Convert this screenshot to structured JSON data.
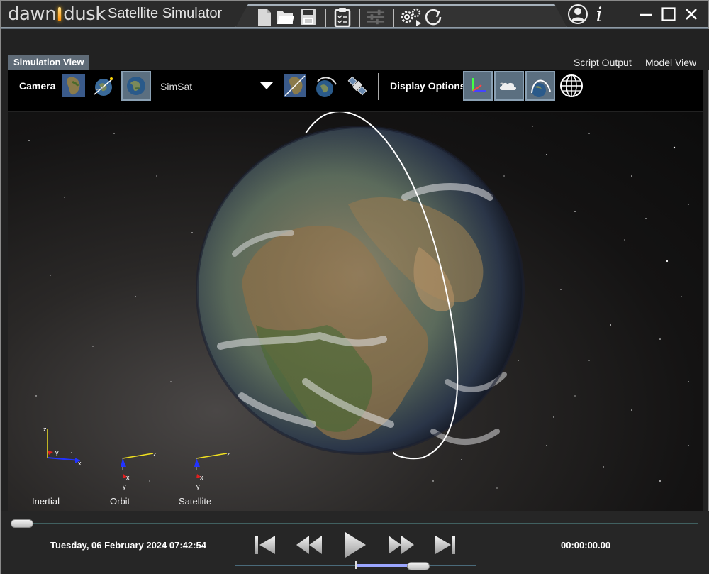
{
  "app": {
    "brand_left": "dawn",
    "brand_right": "dusk",
    "title": "Satellite Simulator"
  },
  "toolbar": {
    "icons": [
      "new-file-icon",
      "open-folder-icon",
      "save-icon",
      "clipboard-checklist-icon",
      "sliders-icon",
      "gears-play-icon",
      "refresh-icon"
    ],
    "right_icons": [
      "user-icon",
      "info-icon"
    ],
    "window_controls": [
      "minimize-icon",
      "maximize-icon",
      "close-icon"
    ]
  },
  "tabs": {
    "active": "Simulation View",
    "others": [
      "Script Output",
      "Model View"
    ]
  },
  "camera_toolbar": {
    "camera_label": "Camera",
    "camera_buttons": [
      "africa-map-icon",
      "satellite-orbit-icon",
      "globe-icon"
    ],
    "selected_object": "SimSat",
    "extra_buttons": [
      "earth-view-icon",
      "earth-orbit-icon",
      "satellite-icon"
    ],
    "display_label": "Display Options",
    "display_buttons": [
      "axes-icon",
      "clouds-icon",
      "orbit-arc-icon",
      "grid-globe-icon"
    ]
  },
  "viewport": {
    "axes": [
      {
        "label": "Inertial",
        "letters": [
          "z",
          "y",
          "x"
        ]
      },
      {
        "label": "Orbit",
        "letters": [
          "z",
          "x",
          "y"
        ]
      },
      {
        "label": "Satellite",
        "letters": [
          "z",
          "x",
          "y"
        ]
      }
    ]
  },
  "playback": {
    "datetime": "Tuesday, 06 February 2024 07:42:54",
    "elapsed": "00:00:00.00",
    "buttons": [
      "skip-to-start-icon",
      "rewind-icon",
      "play-icon",
      "fast-forward-icon",
      "skip-to-end-icon"
    ],
    "timeline_position": 0
  },
  "colors": {
    "accent": "#5f6b77",
    "frame": "#a5b0ba",
    "axis_x": "#2233ff",
    "axis_y": "#e02020",
    "axis_z": "#f0e020"
  }
}
